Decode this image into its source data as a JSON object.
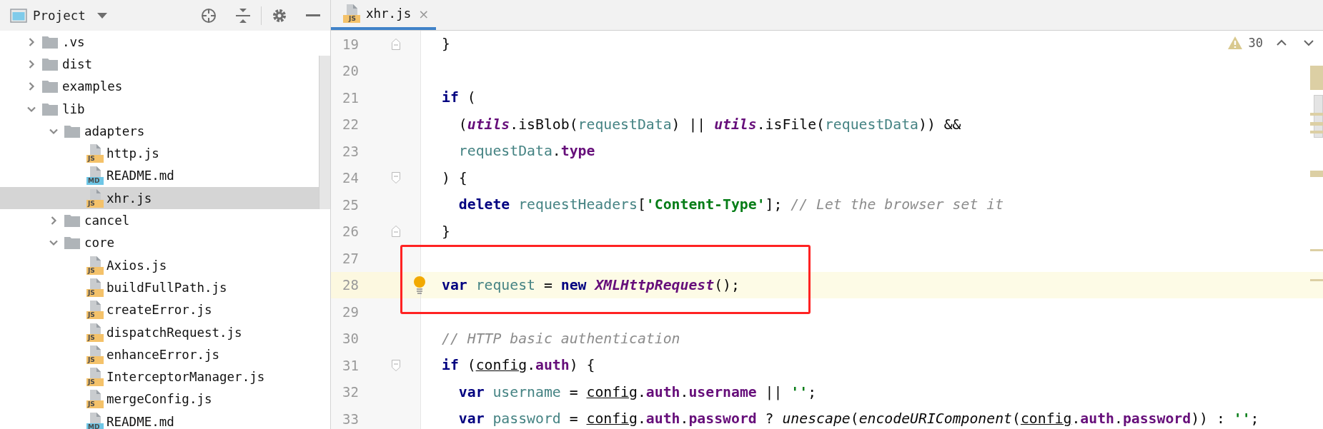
{
  "project_panel": {
    "title": "Project",
    "tree": [
      {
        "label": ".vs",
        "kind": "folder",
        "expanded": false,
        "selected": false
      },
      {
        "label": "dist",
        "kind": "folder",
        "expanded": false,
        "selected": false
      },
      {
        "label": "examples",
        "kind": "folder",
        "expanded": false,
        "selected": false
      },
      {
        "label": "lib",
        "kind": "folder",
        "expanded": true,
        "selected": false,
        "children": [
          {
            "label": "adapters",
            "kind": "folder",
            "expanded": true,
            "selected": false,
            "children": [
              {
                "label": "http.js",
                "kind": "js",
                "badge": "JS",
                "selected": false
              },
              {
                "label": "README.md",
                "kind": "md",
                "badge": "MD",
                "selected": false
              },
              {
                "label": "xhr.js",
                "kind": "js",
                "badge": "JS",
                "selected": true
              }
            ]
          },
          {
            "label": "cancel",
            "kind": "folder",
            "expanded": false,
            "selected": false
          },
          {
            "label": "core",
            "kind": "folder",
            "expanded": true,
            "selected": false,
            "children": [
              {
                "label": "Axios.js",
                "kind": "js",
                "badge": "JS",
                "selected": false
              },
              {
                "label": "buildFullPath.js",
                "kind": "js",
                "badge": "JS",
                "selected": false
              },
              {
                "label": "createError.js",
                "kind": "js",
                "badge": "JS",
                "selected": false
              },
              {
                "label": "dispatchRequest.js",
                "kind": "js",
                "badge": "JS",
                "selected": false
              },
              {
                "label": "enhanceError.js",
                "kind": "js",
                "badge": "JS",
                "selected": false
              },
              {
                "label": "InterceptorManager.js",
                "kind": "js",
                "badge": "JS",
                "selected": false
              },
              {
                "label": "mergeConfig.js",
                "kind": "js",
                "badge": "JS",
                "selected": false
              },
              {
                "label": "README.md",
                "kind": "md",
                "badge": "MD",
                "selected": false
              }
            ]
          }
        ]
      }
    ]
  },
  "editor": {
    "tabs": [
      {
        "label": "xhr.js",
        "kind": "js",
        "badge": "JS",
        "selected": true,
        "close": "×"
      }
    ],
    "inspections": {
      "warnings": "30"
    },
    "lines": [
      {
        "number": "19",
        "current": false,
        "bulb": false,
        "fold": {
          "kind": "end"
        },
        "tokens": [
          {
            "t": "}",
            "kind": "plain"
          }
        ]
      },
      {
        "number": "20",
        "current": false,
        "bulb": false
      },
      {
        "number": "21",
        "current": false,
        "bulb": false,
        "tokens": [
          {
            "t": "if",
            "kind": "kw"
          },
          {
            "t": " (",
            "kind": "plain"
          }
        ]
      },
      {
        "number": "22",
        "current": false,
        "bulb": false,
        "tokens": [
          {
            "t": "  (",
            "kind": "plain"
          },
          {
            "t": "utils",
            "kind": "global"
          },
          {
            "t": ".isBlob(",
            "kind": "plain"
          },
          {
            "t": "requestData",
            "kind": "var"
          },
          {
            "t": ") || ",
            "kind": "plain"
          },
          {
            "t": "utils",
            "kind": "global"
          },
          {
            "t": ".isFile(",
            "kind": "plain"
          },
          {
            "t": "requestData",
            "kind": "var"
          },
          {
            "t": ")) &&",
            "kind": "plain"
          }
        ]
      },
      {
        "number": "23",
        "current": false,
        "bulb": false,
        "tokens": [
          {
            "t": "  requestData",
            "kind": "var"
          },
          {
            "t": ".",
            "kind": "plain"
          },
          {
            "t": "type",
            "kind": "prop"
          }
        ]
      },
      {
        "number": "24",
        "current": false,
        "bulb": false,
        "fold": {
          "kind": "start"
        },
        "tokens": [
          {
            "t": ") {",
            "kind": "plain"
          }
        ]
      },
      {
        "number": "25",
        "current": false,
        "bulb": false,
        "tokens": [
          {
            "t": "  delete",
            "kind": "kw"
          },
          {
            "t": " requestHeaders",
            "kind": "var"
          },
          {
            "t": "[",
            "kind": "plain"
          },
          {
            "t": "'Content-Type'",
            "kind": "str"
          },
          {
            "t": "]; ",
            "kind": "plain"
          },
          {
            "t": "// Let the browser set it",
            "kind": "comment"
          }
        ]
      },
      {
        "number": "26",
        "current": false,
        "bulb": false,
        "fold": {
          "kind": "end"
        },
        "tokens": [
          {
            "t": "}",
            "kind": "plain"
          }
        ]
      },
      {
        "number": "27",
        "current": false,
        "bulb": false
      },
      {
        "number": "28",
        "current": true,
        "bulb": true,
        "tokens": [
          {
            "t": "var",
            "kind": "kw"
          },
          {
            "t": " request",
            "kind": "var"
          },
          {
            "t": " = ",
            "kind": "plain"
          },
          {
            "t": "new",
            "kind": "kw"
          },
          {
            "t": " XMLHttpRequest",
            "kind": "class"
          },
          {
            "t": "();",
            "kind": "plain"
          }
        ]
      },
      {
        "number": "29",
        "current": false,
        "bulb": false
      },
      {
        "number": "30",
        "current": false,
        "bulb": false,
        "tokens": [
          {
            "t": "// HTTP basic authentication",
            "kind": "comment"
          }
        ]
      },
      {
        "number": "31",
        "current": false,
        "bulb": false,
        "fold": {
          "kind": "start"
        },
        "tokens": [
          {
            "t": "if",
            "kind": "kw"
          },
          {
            "t": " (",
            "kind": "plain"
          },
          {
            "t": "config",
            "kind": "ul"
          },
          {
            "t": ".",
            "kind": "plain"
          },
          {
            "t": "auth",
            "kind": "prop"
          },
          {
            "t": ") {",
            "kind": "plain"
          }
        ]
      },
      {
        "number": "32",
        "current": false,
        "bulb": false,
        "tokens": [
          {
            "t": "  var",
            "kind": "kw"
          },
          {
            "t": " username",
            "kind": "var"
          },
          {
            "t": " = ",
            "kind": "plain"
          },
          {
            "t": "config",
            "kind": "ul"
          },
          {
            "t": ".",
            "kind": "plain"
          },
          {
            "t": "auth",
            "kind": "prop"
          },
          {
            "t": ".",
            "kind": "plain"
          },
          {
            "t": "username",
            "kind": "prop"
          },
          {
            "t": " || ",
            "kind": "plain"
          },
          {
            "t": "''",
            "kind": "str"
          },
          {
            "t": ";",
            "kind": "plain"
          }
        ]
      },
      {
        "number": "33",
        "current": false,
        "bulb": false,
        "tokens": [
          {
            "t": "  var",
            "kind": "kw"
          },
          {
            "t": " password",
            "kind": "var"
          },
          {
            "t": " = ",
            "kind": "plain"
          },
          {
            "t": "config",
            "kind": "ul"
          },
          {
            "t": ".",
            "kind": "plain"
          },
          {
            "t": "auth",
            "kind": "prop"
          },
          {
            "t": ".",
            "kind": "plain"
          },
          {
            "t": "password",
            "kind": "prop"
          },
          {
            "t": " ? ",
            "kind": "plain"
          },
          {
            "t": "unescape",
            "kind": "italic"
          },
          {
            "t": "(",
            "kind": "plain"
          },
          {
            "t": "encodeURIComponent",
            "kind": "italic"
          },
          {
            "t": "(",
            "kind": "plain"
          },
          {
            "t": "config",
            "kind": "ul"
          },
          {
            "t": ".",
            "kind": "plain"
          },
          {
            "t": "auth",
            "kind": "prop"
          },
          {
            "t": ".",
            "kind": "plain"
          },
          {
            "t": "password",
            "kind": "prop"
          },
          {
            "t": ")) : ",
            "kind": "plain"
          },
          {
            "t": "''",
            "kind": "str"
          },
          {
            "t": ";",
            "kind": "plain"
          }
        ]
      }
    ]
  }
}
